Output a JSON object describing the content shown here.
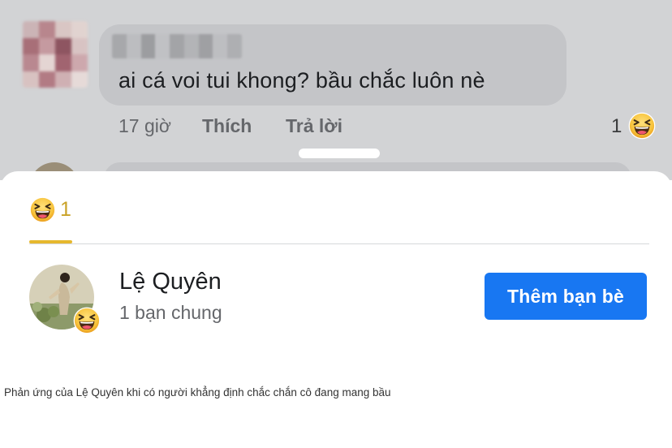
{
  "comment": {
    "text": "ai cá voi tui khong? bầu chắc luôn nè",
    "time": "17 giờ",
    "like_label": "Thích",
    "reply_label": "Trả lời",
    "reaction_count": "1",
    "reaction_icon": "laughing-emoji-icon"
  },
  "reactions_sheet": {
    "tab": {
      "icon": "laughing-emoji-icon",
      "count": "1",
      "accent": "#e6b82e"
    },
    "user": {
      "name": "Lệ Quyên",
      "mutual": "1 bạn chung",
      "reaction_icon": "laughing-emoji-icon"
    },
    "add_friend_label": "Thêm bạn bè",
    "button_color": "#1877f2"
  },
  "caption": "Phản ứng của Lệ Quyên khi có người khẳng định chắc chắn cô đang mang bầu"
}
